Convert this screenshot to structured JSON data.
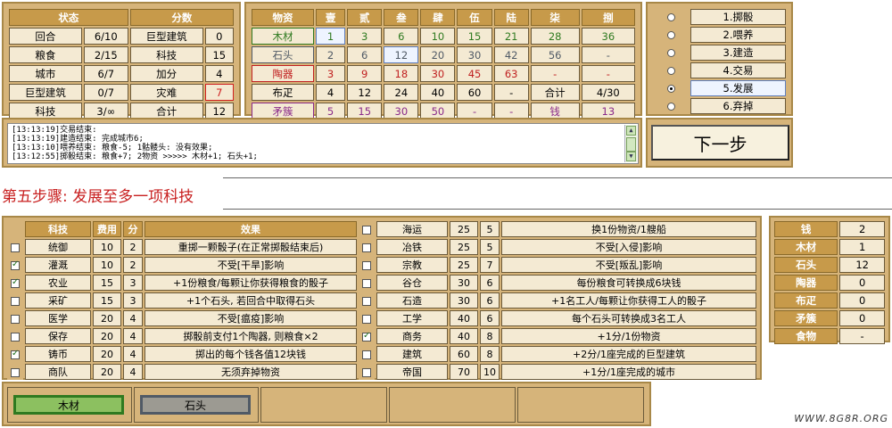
{
  "status": {
    "headers": [
      "状态",
      "分数"
    ],
    "rows": [
      {
        "label": "回合",
        "value": "6/10",
        "slabel": "巨型建筑",
        "svalue": "0"
      },
      {
        "label": "粮食",
        "value": "2/15",
        "slabel": "科技",
        "svalue": "15"
      },
      {
        "label": "城市",
        "value": "6/7",
        "slabel": "加分",
        "svalue": "4"
      },
      {
        "label": "巨型建筑",
        "value": "0/7",
        "slabel": "灾难",
        "svalue": "7"
      },
      {
        "label": "科技",
        "value": "3/∞",
        "slabel": "合计",
        "svalue": "12"
      }
    ]
  },
  "materials": {
    "headers": [
      "物资",
      "壹",
      "贰",
      "叁",
      "肆",
      "伍",
      "陆",
      "柒",
      "捌"
    ],
    "rows": [
      {
        "name": "木材",
        "cells": [
          "1",
          "3",
          "6",
          "10",
          "15",
          "21",
          "28",
          "36"
        ]
      },
      {
        "name": "石头",
        "cells": [
          "2",
          "6",
          "12",
          "20",
          "30",
          "42",
          "56",
          "-"
        ]
      },
      {
        "name": "陶器",
        "cells": [
          "3",
          "9",
          "18",
          "30",
          "45",
          "63",
          "-",
          "-"
        ]
      },
      {
        "name": "布疋",
        "cells": [
          "4",
          "12",
          "24",
          "40",
          "60",
          "-",
          "合计",
          "4/30"
        ]
      },
      {
        "name": "矛簇",
        "cells": [
          "5",
          "15",
          "30",
          "50",
          "-",
          "-",
          "钱",
          "13"
        ]
      }
    ]
  },
  "actions": [
    "1.掷骰",
    "2.喂养",
    "3.建造",
    "4.交易",
    "5.发展",
    "6.弃掉"
  ],
  "log": [
    "[13:13:19]交易结束:",
    "[13:13:19]建造结束: 完成城市6;",
    "[13:13:10]喂养结束: 粮食-5; 1骷髅头: 没有效果;",
    "[13:12:55]掷骰结束: 粮食+7; 2物资 >>>>> 木材+1; 石头+1;"
  ],
  "next_label": "下一步",
  "step_title": "第五步骤: 发展至多一项科技",
  "tech": {
    "headers": [
      "科技",
      "费用",
      "分",
      "效果"
    ],
    "left": [
      {
        "name": "统御",
        "cost": "10",
        "pts": "2",
        "effect": "重掷一颗骰子(在正常掷骰结束后)",
        "checked": false
      },
      {
        "name": "灌溉",
        "cost": "10",
        "pts": "2",
        "effect": "不受[干旱]影响",
        "checked": true
      },
      {
        "name": "农业",
        "cost": "15",
        "pts": "3",
        "effect": "+1份粮食/每颗让你获得粮食的骰子",
        "checked": true
      },
      {
        "name": "采矿",
        "cost": "15",
        "pts": "3",
        "effect": "+1个石头, 若回合中取得石头",
        "checked": false
      },
      {
        "name": "医学",
        "cost": "20",
        "pts": "4",
        "effect": "不受[瘟疫]影响",
        "checked": false
      },
      {
        "name": "保存",
        "cost": "20",
        "pts": "4",
        "effect": "掷骰前支付1个陶器, 则粮食×2",
        "checked": false
      },
      {
        "name": "铸币",
        "cost": "20",
        "pts": "4",
        "effect": "掷出的每个钱各值12块钱",
        "checked": true
      },
      {
        "name": "商队",
        "cost": "20",
        "pts": "4",
        "effect": "无须弃掉物资",
        "checked": false
      }
    ],
    "right": [
      {
        "name": "海运",
        "cost": "25",
        "pts": "5",
        "effect": "换1份物资/1艘船",
        "checked": false
      },
      {
        "name": "冶铁",
        "cost": "25",
        "pts": "5",
        "effect": "不受[入侵]影响",
        "checked": false
      },
      {
        "name": "宗教",
        "cost": "25",
        "pts": "7",
        "effect": "不受[叛乱]影响",
        "checked": false
      },
      {
        "name": "谷仓",
        "cost": "30",
        "pts": "6",
        "effect": "每份粮食可转换成6块钱",
        "checked": false
      },
      {
        "name": "石造",
        "cost": "30",
        "pts": "6",
        "effect": "+1名工人/每颗让你获得工人的骰子",
        "checked": false
      },
      {
        "name": "工学",
        "cost": "40",
        "pts": "6",
        "effect": "每个石头可转换成3名工人",
        "checked": false
      },
      {
        "name": "商务",
        "cost": "40",
        "pts": "8",
        "effect": "+1分/1份物资",
        "checked": true
      },
      {
        "name": "建筑",
        "cost": "60",
        "pts": "8",
        "effect": "+2分/1座完成的巨型建筑",
        "checked": false
      },
      {
        "name": "帝国",
        "cost": "70",
        "pts": "10",
        "effect": "+1分/1座完成的城市",
        "checked": false
      }
    ]
  },
  "resources": [
    {
      "name": "钱",
      "value": "2"
    },
    {
      "name": "木材",
      "value": "1"
    },
    {
      "name": "石头",
      "value": "12"
    },
    {
      "name": "陶器",
      "value": "0"
    },
    {
      "name": "布疋",
      "value": "0"
    },
    {
      "name": "矛簇",
      "value": "0"
    },
    {
      "name": "食物",
      "value": "-"
    }
  ],
  "slots": [
    "木材",
    "石头"
  ],
  "watermark": "WWW.8G8R.ORG",
  "colors": {
    "panel": "#d6b47a",
    "header": "#c79a4a",
    "cell": "#f4ead3",
    "title": "#c82020",
    "wood": "#2f7a20",
    "stone": "#505a66",
    "pottery": "#c02020",
    "spear": "#8a2a8a"
  }
}
